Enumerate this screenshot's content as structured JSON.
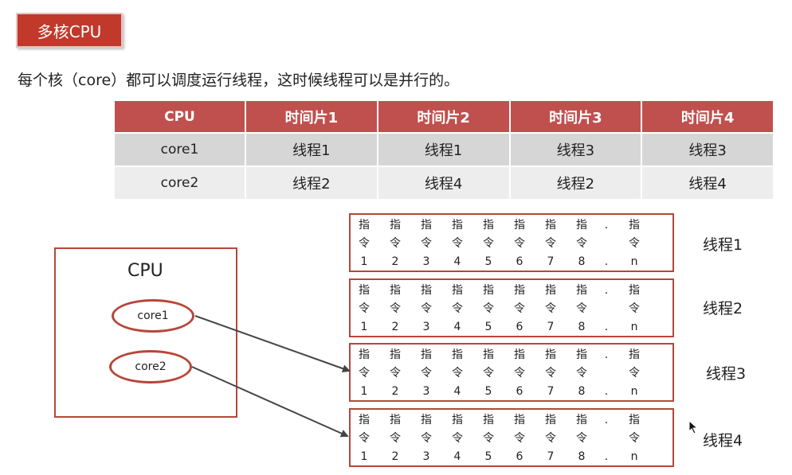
{
  "title": "多核CPU",
  "description": "每个核（core）都可以调度运行线程，这时候线程可以是并行的。",
  "table": {
    "headers": [
      "CPU",
      "时间片1",
      "时间片2",
      "时间片3",
      "时间片4"
    ],
    "rows": [
      [
        "core1",
        "线程1",
        "线程1",
        "线程3",
        "线程3"
      ],
      [
        "core2",
        "线程2",
        "线程4",
        "线程2",
        "线程4"
      ]
    ]
  },
  "diagram": {
    "cpu_label": "CPU",
    "cores": [
      "core1",
      "core2"
    ],
    "instruction_columns": [
      [
        "指",
        "令",
        "1"
      ],
      [
        "指",
        "令",
        "2"
      ],
      [
        "指",
        "令",
        "3"
      ],
      [
        "指",
        "令",
        "4"
      ],
      [
        "指",
        "令",
        "5"
      ],
      [
        "指",
        "令",
        "6"
      ],
      [
        "指",
        "令",
        "7"
      ],
      [
        "指",
        "令",
        "8"
      ],
      [
        ".",
        "",
        "."
      ],
      [
        "指",
        "令",
        "n"
      ]
    ],
    "threads": [
      "线程1",
      "线程2",
      "线程3",
      "线程4"
    ],
    "arrows": [
      {
        "from": "core1",
        "to": "线程3"
      },
      {
        "from": "core2",
        "to": "线程4"
      }
    ]
  },
  "colors": {
    "accent": "#c0504d",
    "border": "#b5473a",
    "row_dark": "#d6d6d6",
    "row_light": "#ededed",
    "arrow": "#444444"
  }
}
